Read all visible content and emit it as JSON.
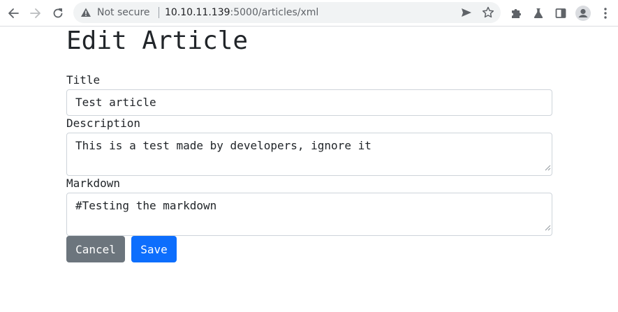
{
  "browser": {
    "security_label": "Not secure",
    "url_host": "10.10.11.139",
    "url_path": ":5000/articles/xml"
  },
  "page": {
    "heading": "Edit Article",
    "title_label": "Title",
    "title_value": "Test article",
    "description_label": "Description",
    "description_value": "This is a test made by developers, ignore it",
    "markdown_label": "Markdown",
    "markdown_value": "#Testing the markdown",
    "cancel_label": "Cancel",
    "save_label": "Save"
  },
  "colors": {
    "primary": "#0d6efd",
    "secondary": "#6c757d",
    "text": "#212529",
    "border": "#ced4da"
  },
  "icons": [
    "back-icon",
    "forward-icon",
    "reload-icon",
    "warning-icon",
    "send-icon",
    "star-icon",
    "extensions-icon",
    "labs-icon",
    "side-panel-icon",
    "profile-icon",
    "menu-icon"
  ]
}
